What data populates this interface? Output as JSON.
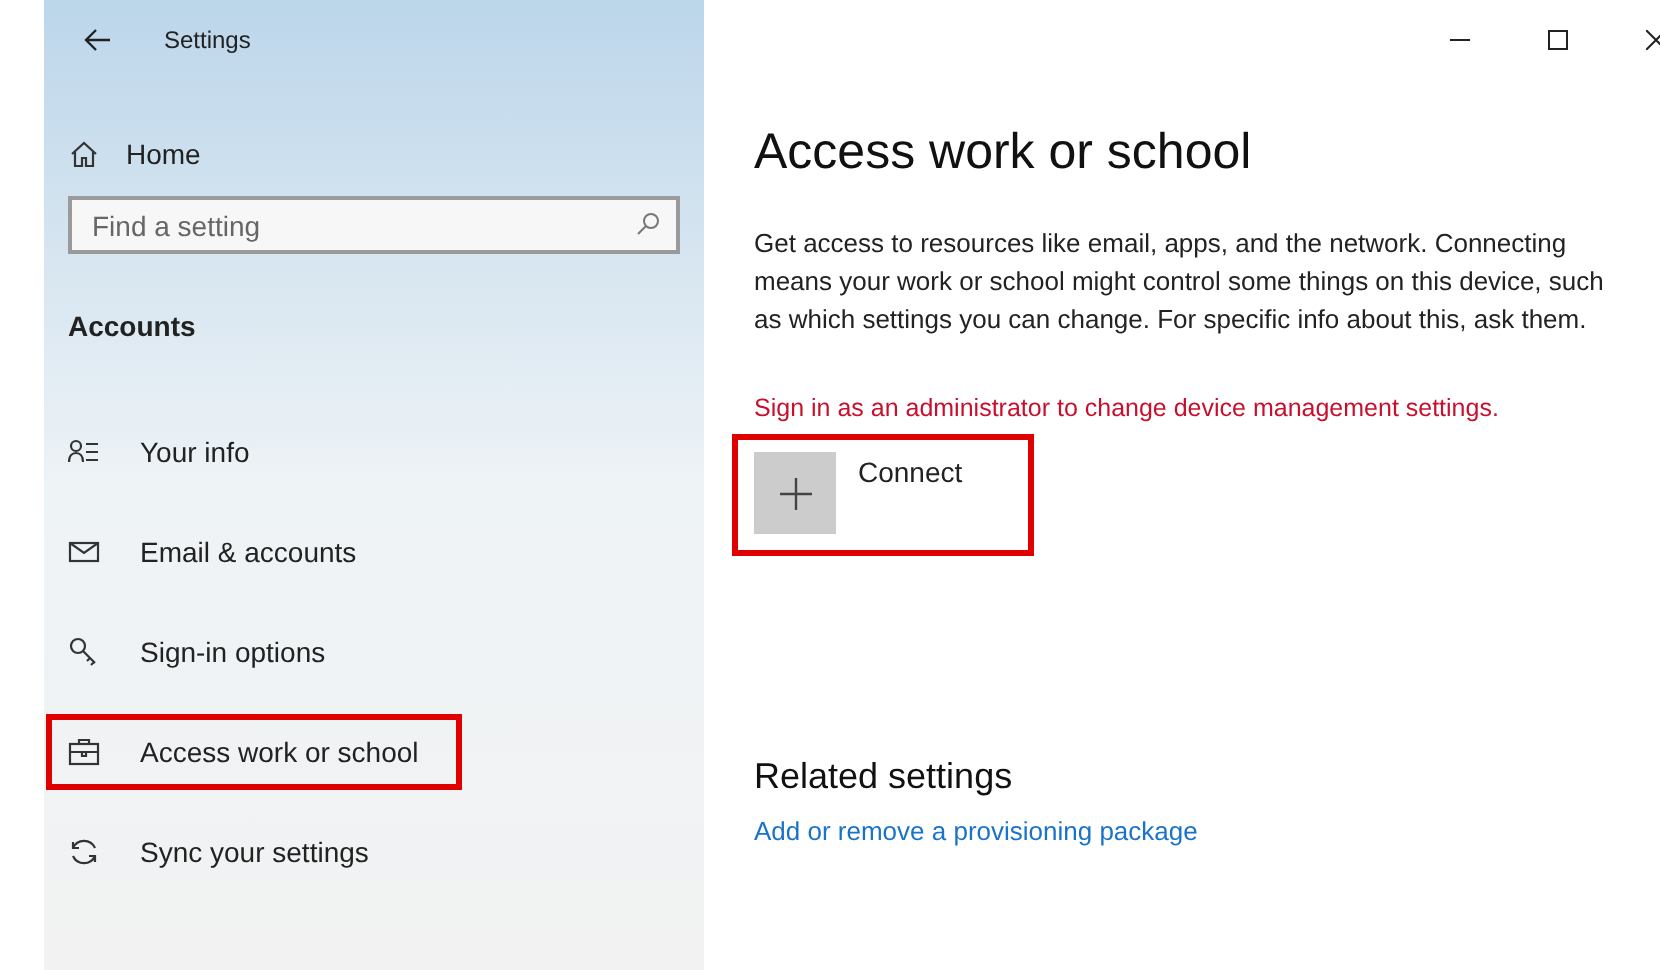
{
  "window": {
    "title": "Settings"
  },
  "sidebar": {
    "home": "Home",
    "search": {
      "placeholder": "Find a setting"
    },
    "section": "Accounts",
    "items": [
      {
        "label": "Your info",
        "highlighted": false
      },
      {
        "label": "Email & accounts",
        "highlighted": false
      },
      {
        "label": "Sign-in options",
        "highlighted": false
      },
      {
        "label": "Access work or school",
        "highlighted": true
      },
      {
        "label": "Sync your settings",
        "highlighted": false
      }
    ]
  },
  "content": {
    "title": "Access work or school",
    "description": "Get access to resources like email, apps, and the network. Connecting means your work or school might control some things on this device, such as which settings you can change. For specific info about this, ask them.",
    "warning": "Sign in as an administrator to change device management settings.",
    "connect": {
      "label": "Connect",
      "highlighted": true
    },
    "related_title": "Related settings",
    "related_link": "Add or remove a provisioning package"
  }
}
